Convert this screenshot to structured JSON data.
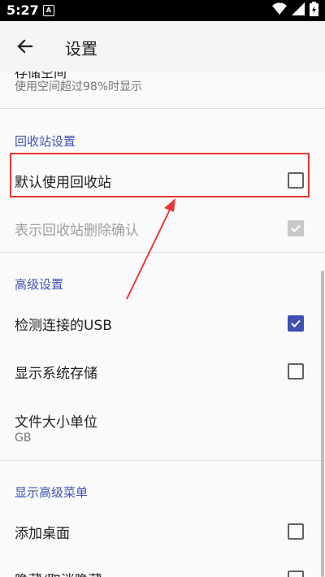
{
  "status_bar": {
    "time": "5:27",
    "notification_letter": "A"
  },
  "app_bar": {
    "title": "设置"
  },
  "top_partial": {
    "title_cut": "存储空间",
    "summary": "使用空间超过98%时显示"
  },
  "sections": [
    {
      "header": "回收站设置",
      "items": [
        {
          "title": "默认使用回收站",
          "checked": false
        },
        {
          "title": "表示回收站删除确认",
          "checked": true,
          "enabled": false
        }
      ]
    },
    {
      "header": "高级设置",
      "items": [
        {
          "title": "检测连接的USB",
          "checked": true
        },
        {
          "title": "显示系统存储",
          "checked": false
        },
        {
          "title": "文件大小单位",
          "summary": "GB"
        }
      ]
    },
    {
      "header": "显示高级菜单",
      "items": [
        {
          "title": "添加桌面",
          "checked": false
        },
        {
          "title": "隐藏/取消隐藏",
          "checked": false
        }
      ]
    }
  ],
  "colors": {
    "accent": "#3f51b5",
    "annotation": "#e53935"
  },
  "icons": {
    "back": "arrow-left-icon",
    "wifi": "wifi-icon",
    "signal": "signal-icon",
    "battery": "battery-icon"
  }
}
